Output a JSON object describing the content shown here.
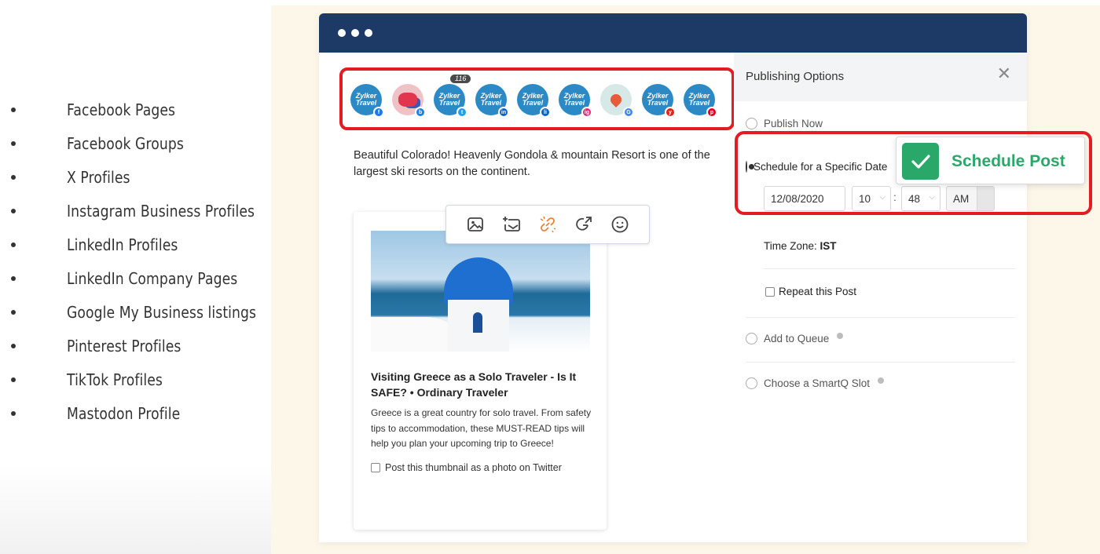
{
  "bullets": [
    "Facebook Pages",
    "Facebook Groups",
    "X Profiles",
    "Instagram Business Profiles",
    "LinkedIn Profiles",
    "LinkedIn Company Pages",
    "Google My Business listings",
    "Pinterest Profiles",
    "TikTok Profiles",
    "Mastodon Profile"
  ],
  "accounts": {
    "brand_label": "Zylker Travel",
    "count_pill": "116",
    "items": [
      {
        "network": "facebook",
        "icon": "facebook-icon",
        "badge": "f",
        "badge_color": "#1877f2"
      },
      {
        "network": "bluesky",
        "icon": "bluesky-icon",
        "badge": "b",
        "badge_color": "#1c80e6"
      },
      {
        "network": "x-twitter",
        "icon": "twitter-icon",
        "badge": "t",
        "badge_color": "#1da1f2"
      },
      {
        "network": "linkedin",
        "icon": "linkedin-icon",
        "badge": "in",
        "badge_color": "#0a66c2"
      },
      {
        "network": "linkedin-company",
        "icon": "linkedin-company-icon",
        "badge": "li",
        "badge_color": "#0a66c2"
      },
      {
        "network": "instagram",
        "icon": "instagram-icon",
        "badge": "ig",
        "badge_color": "#d62976"
      },
      {
        "network": "google-business",
        "icon": "google-business-icon",
        "badge": "G",
        "badge_color": "#4285f4"
      },
      {
        "network": "youtube",
        "icon": "youtube-icon",
        "badge": "y",
        "badge_color": "#e62117"
      },
      {
        "network": "pinterest",
        "icon": "pinterest-icon",
        "badge": "p",
        "badge_color": "#e60023"
      }
    ]
  },
  "post": {
    "text": "Beautiful Colorado! Heavenly Gondola & mountain Resort is one of the largest ski resorts on the continent.",
    "link_card": {
      "title": "Visiting Greece as a Solo Traveler - Is It SAFE? • Ordinary Traveler",
      "description": "Greece is a great country for solo travel. From safety tips to accommodation, these MUST-READ tips will help you plan your upcoming trip to Greece!",
      "thumbnail_option": "Post this thumbnail as a photo on Twitter"
    },
    "toolbar": [
      "image-icon",
      "upload-icon",
      "link-icon",
      "share-icon",
      "emoji-icon"
    ]
  },
  "publishing": {
    "title": "Publishing Options",
    "options": {
      "publish_now": "Publish Now",
      "schedule": "Schedule for a Specific Date",
      "add_queue": "Add to Queue",
      "smartq": "Choose a SmartQ Slot"
    },
    "selected": "schedule",
    "date": "12/08/2020",
    "hour": "10",
    "minute": "48",
    "time_sep": ":",
    "ampm": "AM",
    "timezone_label": "Time Zone:",
    "timezone_value": "IST",
    "repeat": "Repeat this Post"
  },
  "callout": {
    "label": "Schedule Post",
    "color": "#2aa86a"
  },
  "colors": {
    "header": "#1d3a66",
    "highlight": "#e31b23",
    "backdrop": "#fdf7ea"
  }
}
